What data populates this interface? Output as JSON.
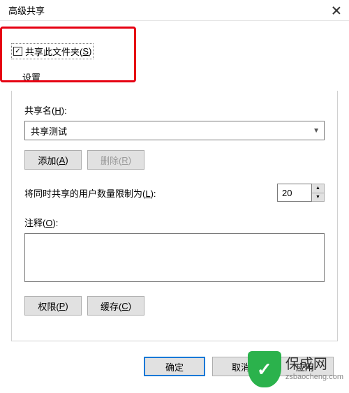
{
  "window": {
    "title": "高级共享"
  },
  "share": {
    "checkboxLabelPre": "共享此文件夹(",
    "checkboxHotkey": "S",
    "checkboxLabelPost": ")",
    "checked": true
  },
  "settings": {
    "header": "设置",
    "shareNameLabelPre": "共享名(",
    "shareNameHotkey": "H",
    "shareNameLabelPost": "):",
    "shareNameValue": "共享测试",
    "addPre": "添加(",
    "addHotkey": "A",
    "addPost": ")",
    "removePre": "删除(",
    "removeHotkey": "R",
    "removePost": ")",
    "limitLabelPre": "将同时共享的用户数量限制为(",
    "limitHotkey": "L",
    "limitLabelPost": "):",
    "limitValue": "20",
    "commentLabelPre": "注释(",
    "commentHotkey": "O",
    "commentLabelPost": "):",
    "commentValue": "",
    "permPre": "权限(",
    "permHotkey": "P",
    "permPost": ")",
    "cachePre": "缓存(",
    "cacheHotkey": "C",
    "cachePost": ")"
  },
  "actions": {
    "ok": "确定",
    "cancel": "取消",
    "apply": "应用"
  },
  "watermark": {
    "cn": "保成网",
    "url": "zsbaocheng.com"
  }
}
